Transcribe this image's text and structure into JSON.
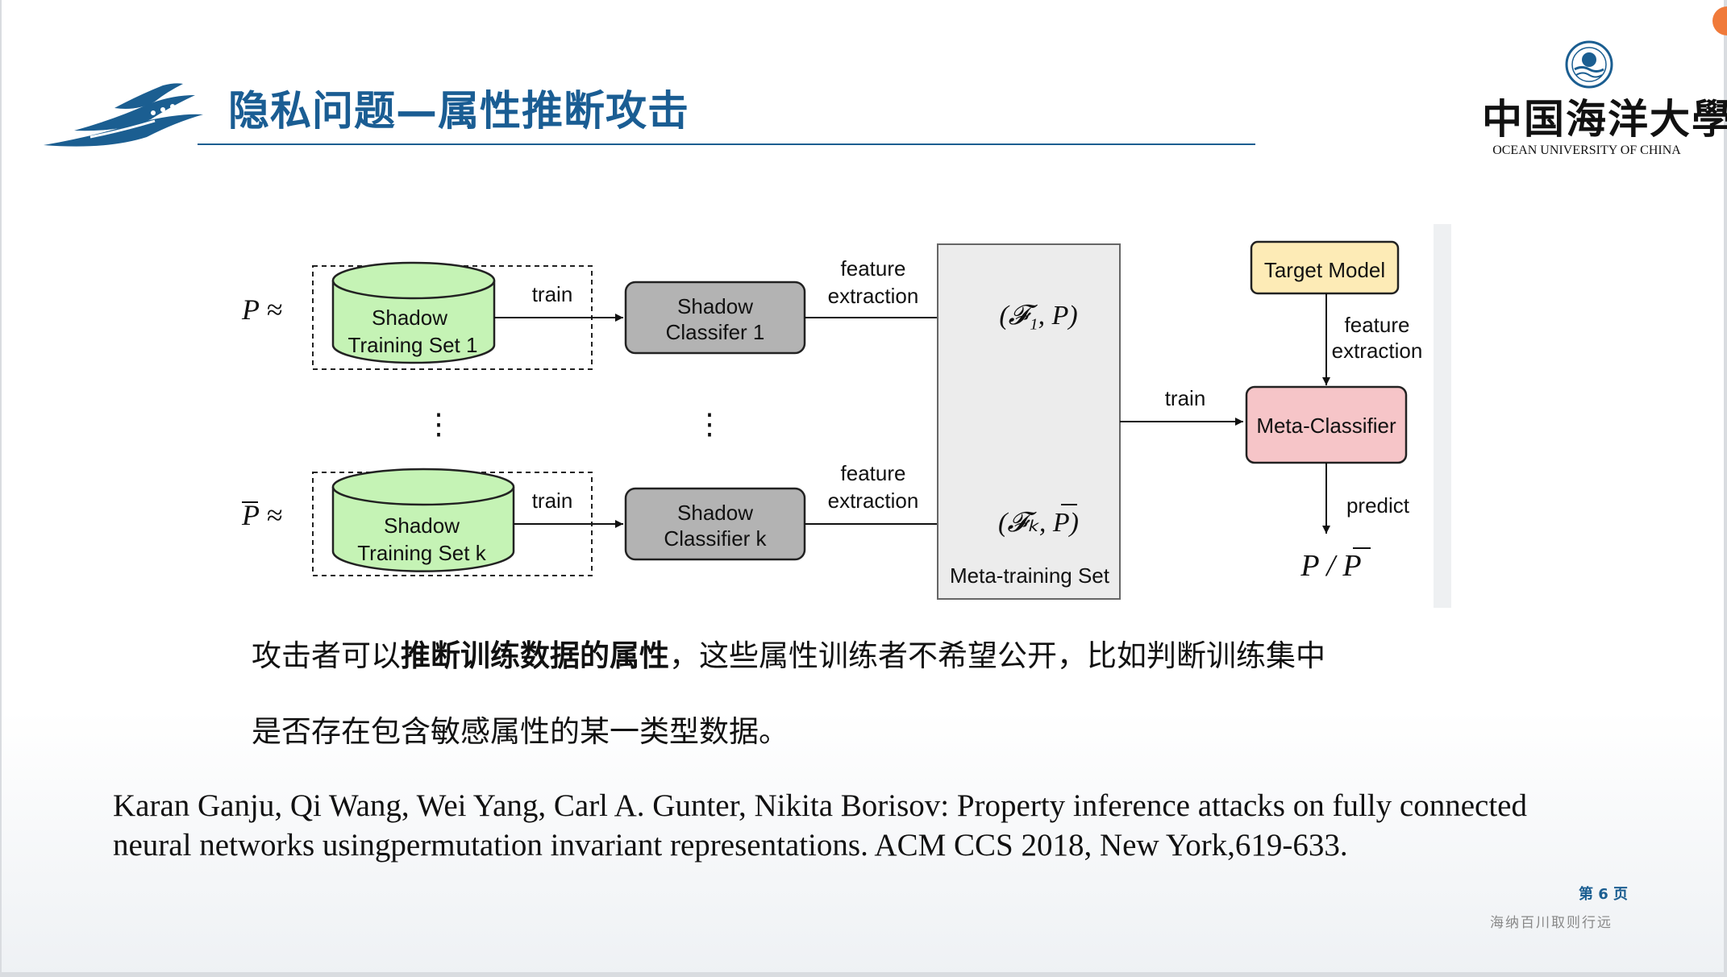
{
  "header": {
    "title": "隐私问题—属性推断攻击",
    "university_cn": "中国海洋大學",
    "university_en": "OCEAN  UNIVERSITY OF CHINA"
  },
  "diagram": {
    "row1_label": "P ≈",
    "row2_label": "P ≈",
    "dataset1": [
      "Shadow",
      "Training Set 1"
    ],
    "datasetk": [
      "Shadow",
      "Training Set k"
    ],
    "train1": "train",
    "traink": "train",
    "classifier1": [
      "Shadow",
      "Classifer 1"
    ],
    "classifierk": [
      "Shadow",
      "Classifier k"
    ],
    "feature_extraction": [
      "feature",
      "extraction"
    ],
    "feature_extraction_k": [
      "feature",
      "extraction"
    ],
    "vec1": "(𝓕₁, P)",
    "veck": "(𝓕ₖ, P)",
    "dots": "⋮",
    "meta_set": "Meta-training Set",
    "train_meta": "train",
    "target_model": "Target Model",
    "target_feature": [
      "feature",
      "extraction"
    ],
    "meta_classifier": "Meta-Classifier",
    "predict": "predict",
    "output": "P / P"
  },
  "body": {
    "line1_pre": "攻击者可以",
    "line1_bold": "推断训练数据的属性",
    "line1_post": "，这些属性训练者不希望公开，比如判断训练集中",
    "line2": "是否存在包含敏感属性的某一类型数据。"
  },
  "citation": {
    "line1": "Karan Ganju, Qi Wang, Wei Yang, Carl A. Gunter, Nikita Borisov: Property inference attacks on fully connected",
    "line2": "neural networks usingpermutation invariant representations. ACM CCS 2018, New York,619-633."
  },
  "footer": {
    "page": "第 6 页",
    "motto": "海纳百川取则行远"
  },
  "colors": {
    "title_blue": "#1a5d93",
    "dataset_green": "#c5f3b5",
    "classifier_gray": "#b3b3b3",
    "target_yellow": "#fdebb6",
    "meta_red": "#f6c5c8"
  }
}
